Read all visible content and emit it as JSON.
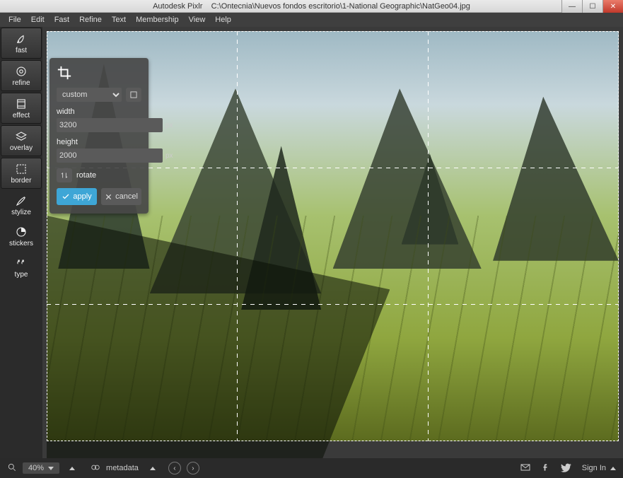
{
  "titlebar": {
    "app_name": "Autodesk Pixlr",
    "file_path": "C:\\Ontecnia\\Nuevos fondos escritorio\\1-National Geographic\\NatGeo04.jpg"
  },
  "menu": [
    "File",
    "Edit",
    "Fast",
    "Refine",
    "Text",
    "Membership",
    "View",
    "Help"
  ],
  "sidebar": {
    "tools": [
      {
        "id": "fast",
        "label": "fast"
      },
      {
        "id": "refine",
        "label": "refine"
      },
      {
        "id": "effect",
        "label": "effect"
      },
      {
        "id": "overlay",
        "label": "overlay"
      },
      {
        "id": "border",
        "label": "border"
      },
      {
        "id": "stylize",
        "label": "stylize"
      },
      {
        "id": "stickers",
        "label": "stickers"
      },
      {
        "id": "type",
        "label": "type"
      }
    ]
  },
  "crop_panel": {
    "preset": "custom",
    "width_label": "width",
    "width_value": "3200",
    "height_label": "height",
    "height_value": "2000",
    "unit": "px",
    "rotate_label": "rotate",
    "apply_label": "apply",
    "cancel_label": "cancel"
  },
  "statusbar": {
    "zoom": "40%",
    "metadata_label": "metadata",
    "signin_label": "Sign In"
  }
}
